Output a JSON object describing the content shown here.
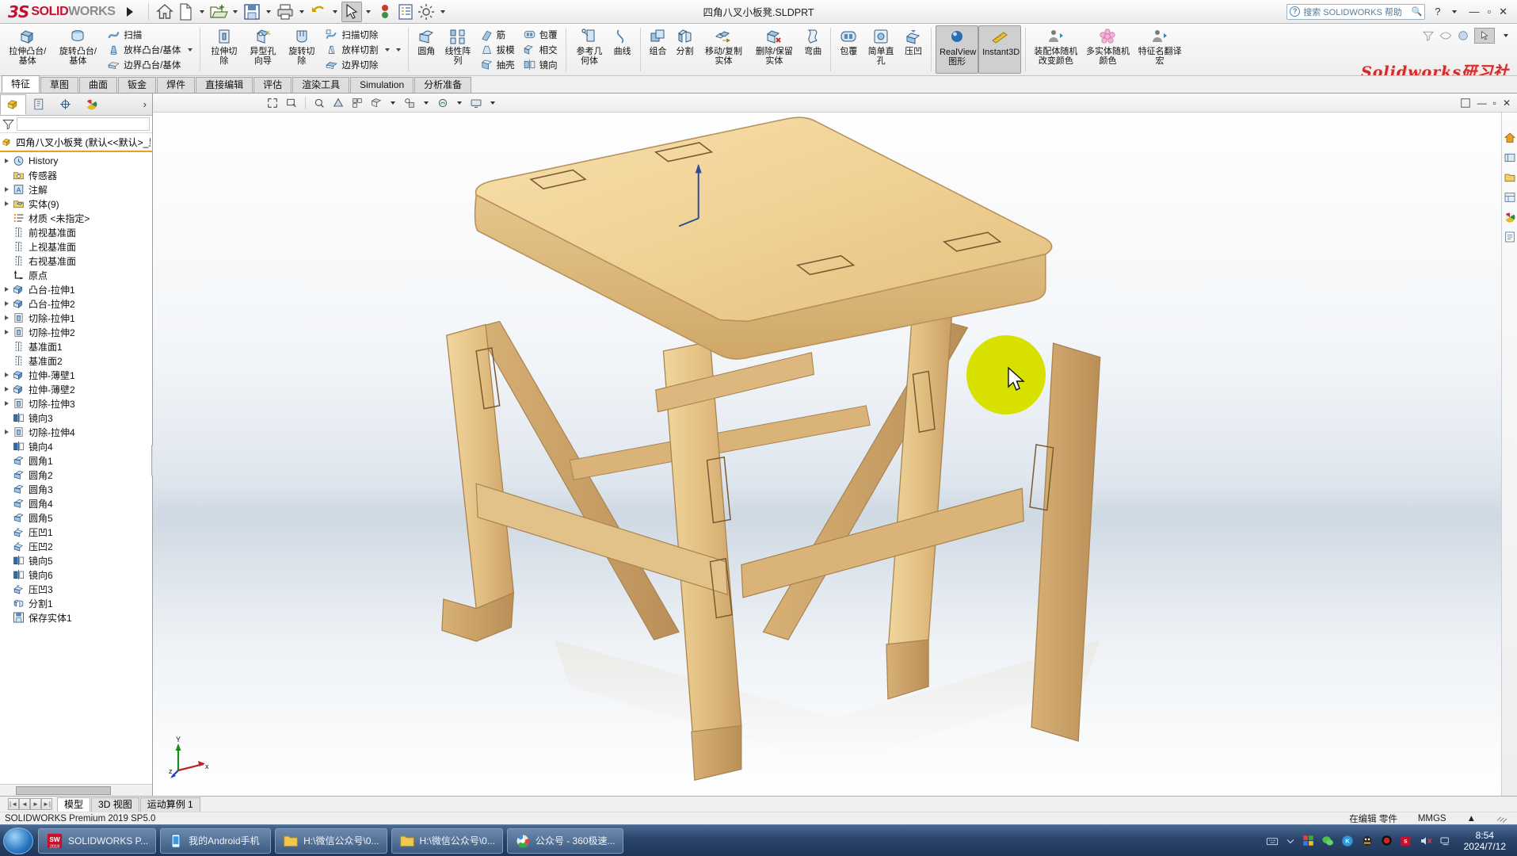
{
  "titlebar": {
    "logo_ds": "3S",
    "logo_solid": "SOLID",
    "logo_works": "WORKS",
    "document_title": "四角八叉小板凳.SLDPRT",
    "quick_access": [
      {
        "name": "home-icon",
        "label": "主页"
      },
      {
        "name": "new-document-icon",
        "label": "新建"
      },
      {
        "name": "open-folder-icon",
        "label": "打开"
      },
      {
        "name": "save-icon",
        "label": "保存"
      },
      {
        "name": "print-icon",
        "label": "打印"
      },
      {
        "name": "undo-icon",
        "label": "撤消"
      },
      {
        "name": "select-cursor-icon",
        "label": "选择"
      },
      {
        "name": "rebuild-icon",
        "label": "重建模型"
      },
      {
        "name": "file-properties-icon",
        "label": "文件属性"
      },
      {
        "name": "options-gear-icon",
        "label": "选项"
      }
    ],
    "search_placeholder": "搜索 SOLIDWORKS 帮助",
    "help_label": "?",
    "minimize": "—",
    "maximize": "▫",
    "close": "✕"
  },
  "ribbon": {
    "watermark": "Solidworks研习社",
    "groups": [
      {
        "name": "boss-base-group",
        "commands": [
          {
            "label": "拉伸凸台/基体",
            "icon": "extrude-boss-icon",
            "layout": "big"
          },
          {
            "label": "旋转凸台/基体",
            "icon": "revolve-boss-icon",
            "layout": "big"
          }
        ],
        "stack": [
          {
            "label": "扫描",
            "icon": "sweep-icon"
          },
          {
            "label": "放样凸台/基体",
            "icon": "loft-icon"
          },
          {
            "label": "边界凸台/基体",
            "icon": "boundary-boss-icon"
          }
        ]
      },
      {
        "name": "cut-group",
        "commands": [
          {
            "label": "拉伸切除",
            "icon": "extrude-cut-icon",
            "layout": "big"
          },
          {
            "label": "异型孔向导",
            "icon": "hole-wizard-icon",
            "layout": "big"
          },
          {
            "label": "旋转切除",
            "icon": "revolve-cut-icon",
            "layout": "big"
          }
        ],
        "stack": [
          {
            "label": "扫描切除",
            "icon": "sweep-cut-icon"
          },
          {
            "label": "放样切割",
            "icon": "loft-cut-icon"
          },
          {
            "label": "边界切除",
            "icon": "boundary-cut-icon"
          }
        ]
      },
      {
        "name": "features-group",
        "commands": [
          {
            "label": "圆角",
            "icon": "fillet-icon",
            "layout": "big"
          },
          {
            "label": "线性阵列",
            "icon": "linear-pattern-icon",
            "layout": "big"
          }
        ],
        "stack": [
          {
            "label": "筋",
            "icon": "rib-icon"
          },
          {
            "label": "拔模",
            "icon": "draft-icon"
          },
          {
            "label": "抽壳",
            "icon": "shell-icon"
          }
        ],
        "stack2": [
          {
            "label": "包覆",
            "icon": "wrap-icon"
          },
          {
            "label": "相交",
            "icon": "intersect-icon"
          },
          {
            "label": "镜向",
            "icon": "mirror-icon"
          }
        ]
      },
      {
        "name": "reference-group",
        "commands": [
          {
            "label": "参考几何体",
            "icon": "reference-geometry-icon",
            "layout": "big"
          },
          {
            "label": "曲线",
            "icon": "curves-icon",
            "layout": "big"
          }
        ]
      },
      {
        "name": "bodies-group",
        "commands": [
          {
            "label": "组合",
            "icon": "combine-icon",
            "layout": "big"
          },
          {
            "label": "分割",
            "icon": "split-icon",
            "layout": "big"
          },
          {
            "label": "移动/复制实体",
            "icon": "move-copy-body-icon",
            "layout": "big"
          },
          {
            "label": "删除/保留实体",
            "icon": "delete-keep-body-icon",
            "layout": "big"
          },
          {
            "label": "弯曲",
            "icon": "flex-icon",
            "layout": "big"
          }
        ]
      },
      {
        "name": "misc-group",
        "commands": [
          {
            "label": "包覆",
            "icon": "wrap-big-icon",
            "layout": "big"
          },
          {
            "label": "简单直孔",
            "icon": "simple-hole-icon",
            "layout": "big"
          },
          {
            "label": "压凹",
            "icon": "indent-icon",
            "layout": "big"
          }
        ]
      },
      {
        "name": "display-group",
        "commands": [
          {
            "label": "RealView 图形",
            "icon": "realview-icon",
            "layout": "big",
            "selected": true
          },
          {
            "label": "Instant3D",
            "icon": "instant3d-icon",
            "layout": "big",
            "selected": true
          }
        ]
      },
      {
        "name": "macro-group",
        "commands": [
          {
            "label": "装配体随机改变颜色",
            "icon": "assembly-random-color-icon",
            "layout": "big"
          },
          {
            "label": "多实体随机颜色",
            "icon": "multibody-random-color-icon",
            "layout": "big"
          },
          {
            "label": "特征名翻译宏",
            "icon": "feature-translate-icon",
            "layout": "big"
          }
        ]
      }
    ]
  },
  "tabs": [
    {
      "label": "特征",
      "active": true
    },
    {
      "label": "草图",
      "active": false
    },
    {
      "label": "曲面",
      "active": false
    },
    {
      "label": "钣金",
      "active": false
    },
    {
      "label": "焊件",
      "active": false
    },
    {
      "label": "直接编辑",
      "active": false
    },
    {
      "label": "评估",
      "active": false
    },
    {
      "label": "渲染工具",
      "active": false
    },
    {
      "label": "Simulation",
      "active": false
    },
    {
      "label": "分析准备",
      "active": false
    }
  ],
  "tree_panel": {
    "tabs": [
      {
        "name": "feature-manager-tab",
        "active": true
      },
      {
        "name": "property-manager-tab",
        "active": false
      },
      {
        "name": "configuration-manager-tab",
        "active": false
      },
      {
        "name": "display-manager-tab",
        "active": false
      }
    ],
    "expand_label": "›",
    "filter_placeholder": "",
    "root": "四角八叉小板凳  (默认<<默认>_显示状",
    "items": [
      {
        "label": "History",
        "icon": "history-icon",
        "expandable": true,
        "indent": 1
      },
      {
        "label": "传感器",
        "icon": "sensors-icon",
        "expandable": false,
        "indent": 1
      },
      {
        "label": "注解",
        "icon": "annotations-icon",
        "expandable": true,
        "indent": 1
      },
      {
        "label": "实体(9)",
        "icon": "solid-bodies-icon",
        "expandable": true,
        "indent": 1
      },
      {
        "label": "材质 <未指定>",
        "icon": "material-icon",
        "expandable": false,
        "indent": 1
      },
      {
        "label": "前视基准面",
        "icon": "plane-icon",
        "expandable": false,
        "indent": 1
      },
      {
        "label": "上视基准面",
        "icon": "plane-icon",
        "expandable": false,
        "indent": 1
      },
      {
        "label": "右视基准面",
        "icon": "plane-icon",
        "expandable": false,
        "indent": 1
      },
      {
        "label": "原点",
        "icon": "origin-icon",
        "expandable": false,
        "indent": 1
      },
      {
        "label": "凸台-拉伸1",
        "icon": "boss-extrude-icon",
        "expandable": true,
        "indent": 1
      },
      {
        "label": "凸台-拉伸2",
        "icon": "boss-extrude-icon",
        "expandable": true,
        "indent": 1
      },
      {
        "label": "切除-拉伸1",
        "icon": "cut-extrude-icon",
        "expandable": true,
        "indent": 1
      },
      {
        "label": "切除-拉伸2",
        "icon": "cut-extrude-icon",
        "expandable": true,
        "indent": 1
      },
      {
        "label": "基准面1",
        "icon": "plane-icon",
        "expandable": false,
        "indent": 1
      },
      {
        "label": "基准面2",
        "icon": "plane-icon",
        "expandable": false,
        "indent": 1
      },
      {
        "label": "拉伸-薄壁1",
        "icon": "boss-extrude-icon",
        "expandable": true,
        "indent": 1
      },
      {
        "label": "拉伸-薄壁2",
        "icon": "boss-extrude-icon",
        "expandable": true,
        "indent": 1
      },
      {
        "label": "切除-拉伸3",
        "icon": "cut-extrude-icon",
        "expandable": true,
        "indent": 1
      },
      {
        "label": "镜向3",
        "icon": "mirror-tree-icon",
        "expandable": false,
        "indent": 1
      },
      {
        "label": "切除-拉伸4",
        "icon": "cut-extrude-icon",
        "expandable": true,
        "indent": 1
      },
      {
        "label": "镜向4",
        "icon": "mirror-tree-icon",
        "expandable": false,
        "indent": 1
      },
      {
        "label": "圆角1",
        "icon": "fillet-tree-icon",
        "expandable": false,
        "indent": 1
      },
      {
        "label": "圆角2",
        "icon": "fillet-tree-icon",
        "expandable": false,
        "indent": 1
      },
      {
        "label": "圆角3",
        "icon": "fillet-tree-icon",
        "expandable": false,
        "indent": 1
      },
      {
        "label": "圆角4",
        "icon": "fillet-tree-icon",
        "expandable": false,
        "indent": 1
      },
      {
        "label": "圆角5",
        "icon": "fillet-tree-icon",
        "expandable": false,
        "indent": 1
      },
      {
        "label": "压凹1",
        "icon": "indent-tree-icon",
        "expandable": false,
        "indent": 1
      },
      {
        "label": "压凹2",
        "icon": "indent-tree-icon",
        "expandable": false,
        "indent": 1
      },
      {
        "label": "镜向5",
        "icon": "mirror-tree-icon",
        "expandable": false,
        "indent": 1
      },
      {
        "label": "镜向6",
        "icon": "mirror-tree-icon",
        "expandable": false,
        "indent": 1
      },
      {
        "label": "压凹3",
        "icon": "indent-tree-icon",
        "expandable": false,
        "indent": 1
      },
      {
        "label": "分割1",
        "icon": "split-tree-icon",
        "expandable": false,
        "indent": 1
      },
      {
        "label": "保存实体1",
        "icon": "save-bodies-icon",
        "expandable": false,
        "indent": 1
      }
    ]
  },
  "graphics": {
    "model_name": "四角八叉小板凳",
    "triad_labels": {
      "x": "x",
      "y": "Y",
      "z": "z"
    },
    "origin_label": "原点"
  },
  "document_tabs": {
    "nav": [
      "|◄",
      "◄",
      "►",
      "►|"
    ],
    "tabs": [
      {
        "label": "模型",
        "active": true
      },
      {
        "label": "3D 视图",
        "active": false
      },
      {
        "label": "运动算例 1",
        "active": false
      }
    ]
  },
  "statusbar": {
    "left": "SOLIDWORKS Premium 2019 SP5.0",
    "editing": "在编辑 零件",
    "units": "MMGS",
    "units_caret": "▲"
  },
  "taskbar": {
    "items": [
      {
        "label": "SOLIDWORKS P...",
        "icon": "solidworks-taskbar-icon",
        "badge": "2019"
      },
      {
        "label": "我的Android手机",
        "icon": "phone-icon"
      },
      {
        "label": "H:\\微信公众号\\0...",
        "icon": "folder-icon"
      },
      {
        "label": "H:\\微信公众号\\0...",
        "icon": "folder-icon"
      },
      {
        "label": "公众号 - 360极速...",
        "icon": "browser-icon"
      }
    ],
    "tray": [
      {
        "name": "keyboard-tray-icon"
      },
      {
        "name": "show-hidden-tray-icon"
      },
      {
        "name": "windows-tray-icon"
      },
      {
        "name": "wechat-tray-icon"
      },
      {
        "name": "kingsoft-tray-icon"
      },
      {
        "name": "qq-tray-icon"
      },
      {
        "name": "record-tray-icon"
      },
      {
        "name": "solidworks-tray-icon"
      },
      {
        "name": "volume-muted-tray-icon"
      },
      {
        "name": "network-tray-icon"
      }
    ],
    "time": "8:54",
    "date": "2024/7/12"
  }
}
